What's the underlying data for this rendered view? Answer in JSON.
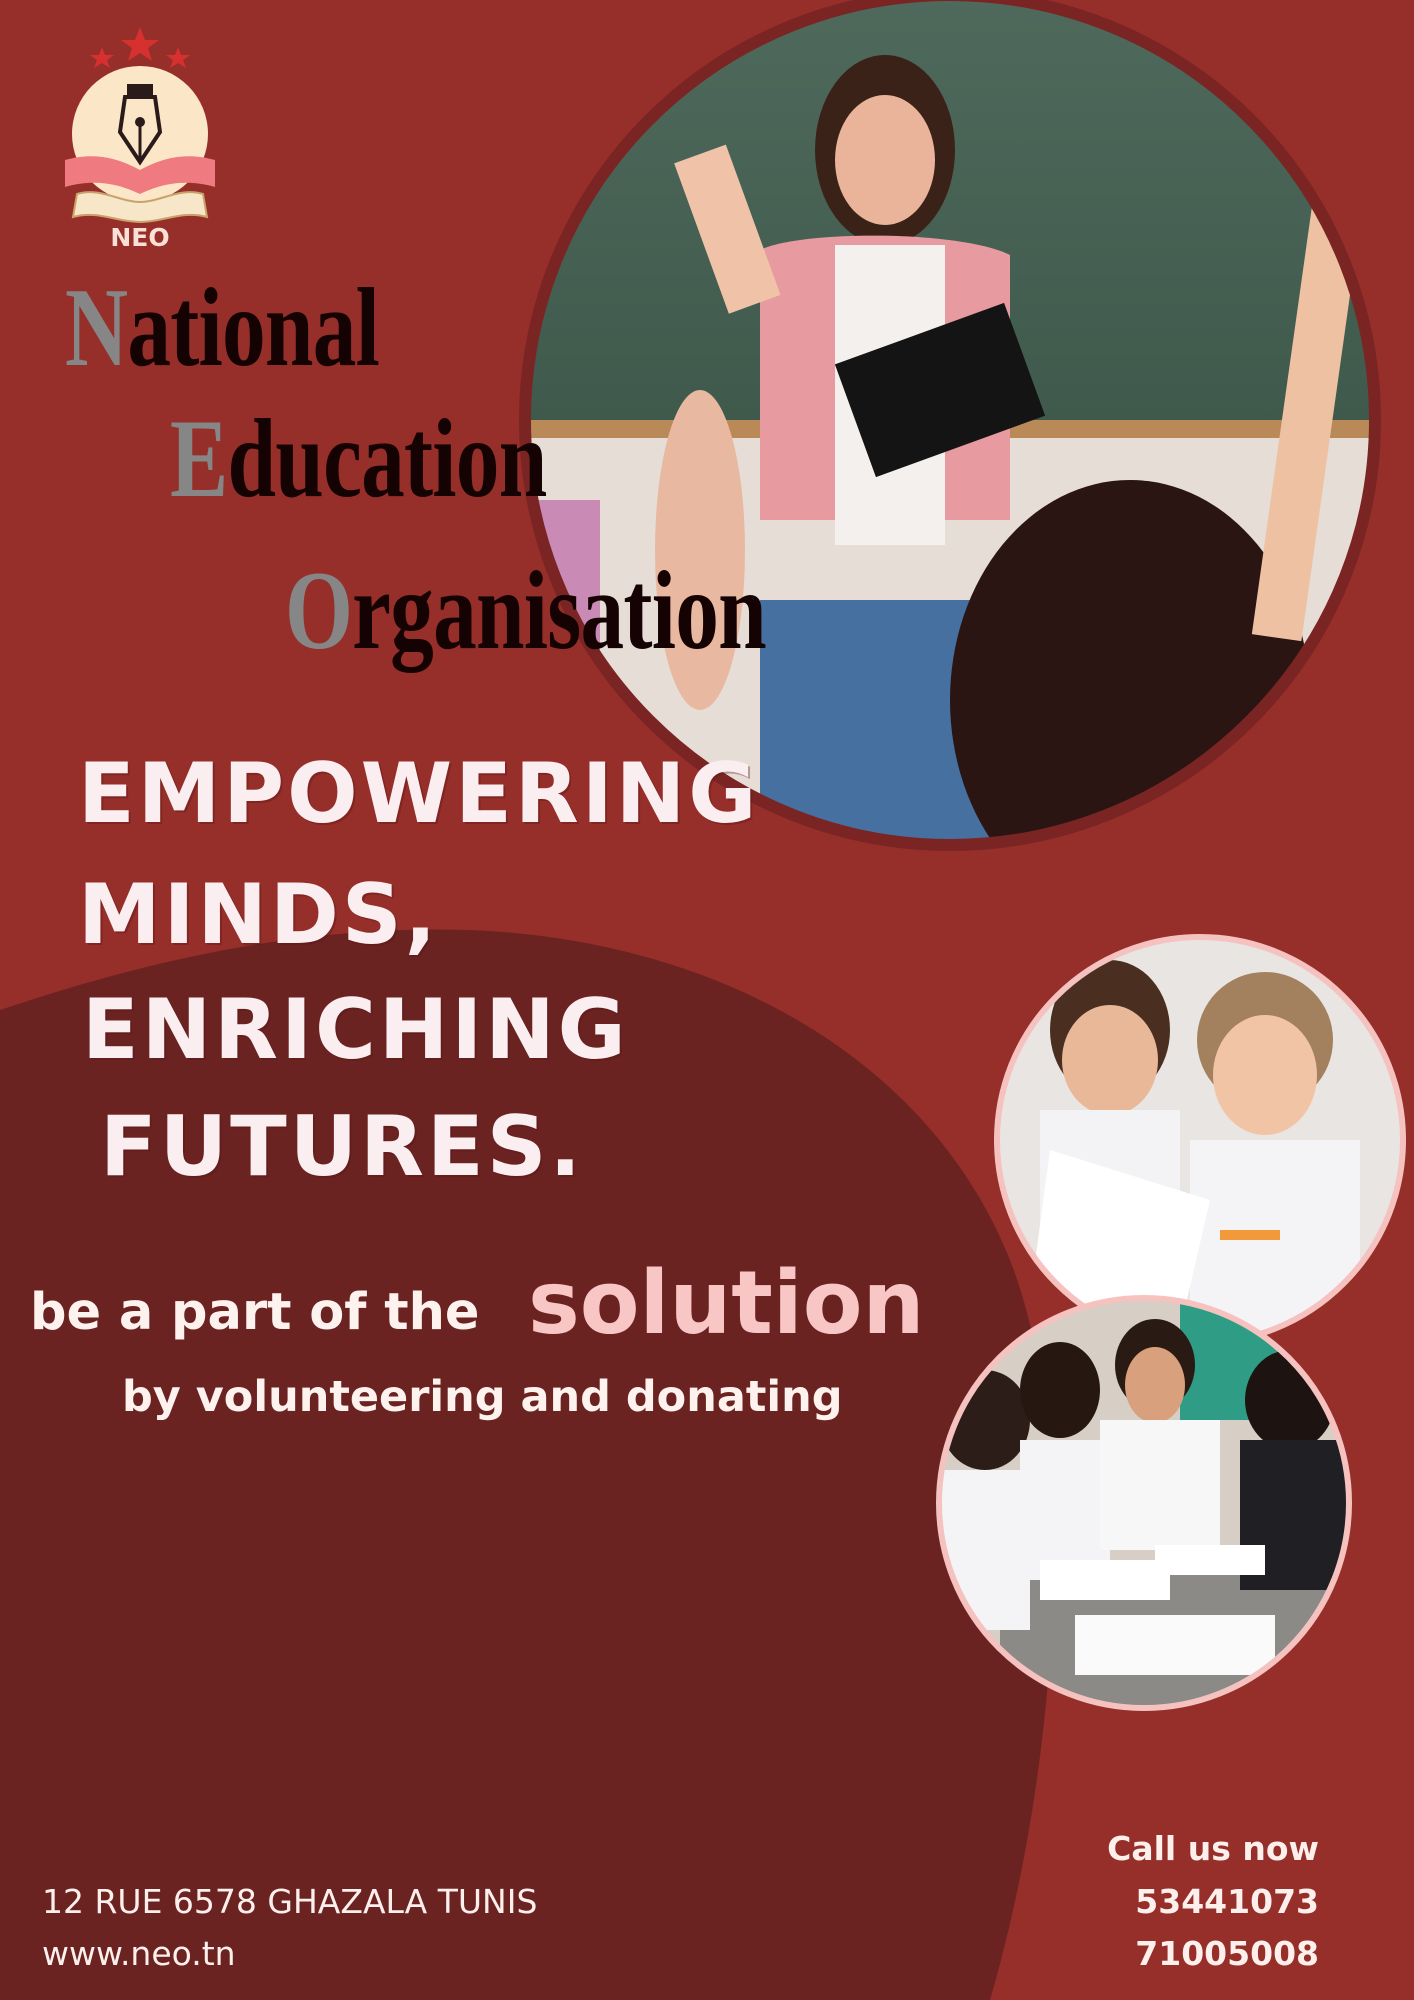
{
  "logo": {
    "abbreviation": "NEO"
  },
  "organisation": {
    "lines": [
      {
        "initial": "N",
        "rest": "ational"
      },
      {
        "initial": "E",
        "rest": "ducation"
      },
      {
        "initial": "O",
        "rest": "rganisation"
      }
    ]
  },
  "headline": {
    "line1": "EMPOWERING",
    "line2": "MINDS,",
    "line3": "ENRICHING",
    "line4": "FUTURES."
  },
  "cta": {
    "prefix": "be a part of the",
    "highlight": "solution",
    "subline": "by volunteering and donating"
  },
  "contact": {
    "address": "12 RUE 6578 GHAZALA TUNIS",
    "website": "www.neo.tn",
    "call_label": "Call us now",
    "phone1": "53441073",
    "phone2": "71005008"
  },
  "colors": {
    "background": "#962f2a",
    "dark_wave": "#6b2322",
    "accent_pink": "#f8c6c4"
  }
}
